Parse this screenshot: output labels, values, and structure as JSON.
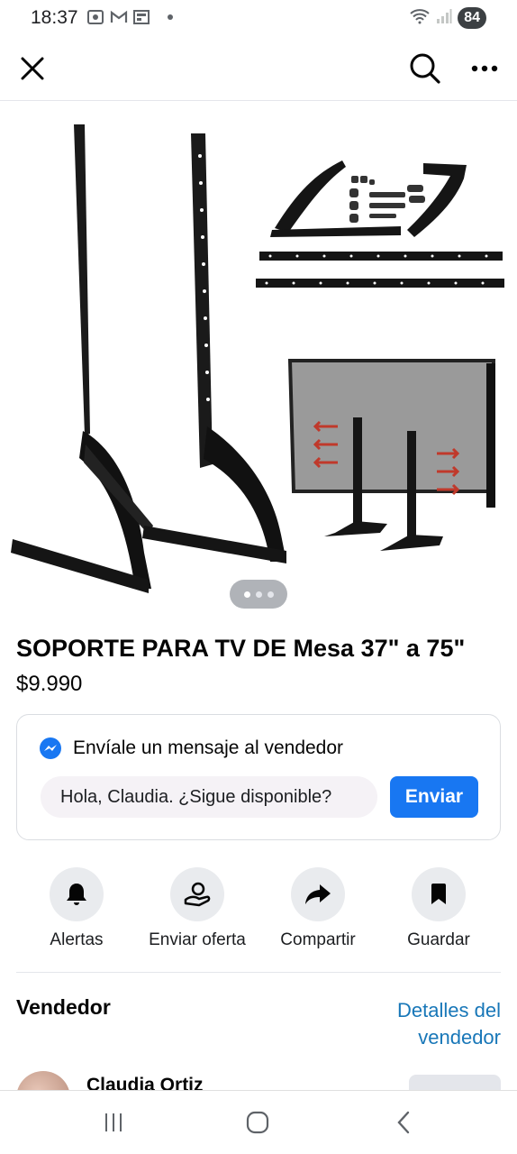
{
  "status_bar": {
    "time": "18:37",
    "battery": "84",
    "icons": [
      "screenshot-icon",
      "gmail-icon",
      "news-icon",
      "wifi-icon",
      "signal-icon"
    ]
  },
  "top_bar": {
    "icons": [
      "close-icon",
      "search-icon",
      "more-icon"
    ]
  },
  "listing": {
    "title": "SOPORTE PARA TV DE Mesa 37\" a 75\"",
    "price": "$9.990",
    "image_count": 3,
    "active_image": 0
  },
  "message_card": {
    "heading": "Envíale un mensaje al vendedor",
    "input_value": "Hola, Claudia. ¿Sigue disponible?",
    "send_label": "Enviar"
  },
  "actions": [
    {
      "label": "Alertas",
      "icon": "bell-icon"
    },
    {
      "label": "Enviar oferta",
      "icon": "offer-icon"
    },
    {
      "label": "Compartir",
      "icon": "share-icon"
    },
    {
      "label": "Guardar",
      "icon": "bookmark-icon"
    }
  ],
  "seller": {
    "heading": "Vendedor",
    "details_link": "Detalles del vendedor",
    "name": "Claudia Ortiz"
  },
  "nav_bar": {
    "icons": [
      "recent-apps-icon",
      "home-icon",
      "back-icon"
    ]
  },
  "colors": {
    "accent": "#1877f2",
    "link": "#1877b8",
    "action_bg": "#e9ebee"
  }
}
